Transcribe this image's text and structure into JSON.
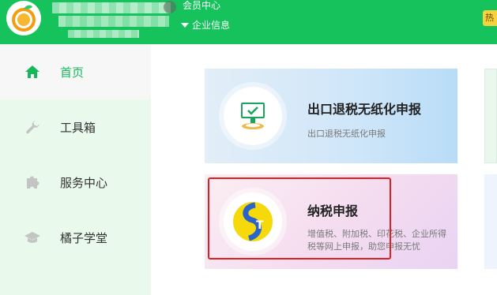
{
  "header": {
    "member_center": "会员中心",
    "company_info": "企业信息",
    "hot_badge": "热",
    "accent": "#15c25b"
  },
  "sidebar": {
    "items": [
      {
        "label": "首页",
        "icon": "home-icon",
        "active": true
      },
      {
        "label": "工具箱",
        "icon": "wrench-icon",
        "active": false
      },
      {
        "label": "服务中心",
        "icon": "puzzle-icon",
        "active": false
      },
      {
        "label": "橘子学堂",
        "icon": "graduation-cap-icon",
        "active": false
      }
    ]
  },
  "cards": [
    {
      "title": "出口退税无纸化申报",
      "desc": "出口退税无纸化申报",
      "icon": "monitor-check-icon"
    },
    {
      "title": "纳税申报",
      "desc": "增值税、附加税、印花税、企业所得税等网上申报，助您申报无忧",
      "icon": "tax-st-logo-icon"
    }
  ]
}
